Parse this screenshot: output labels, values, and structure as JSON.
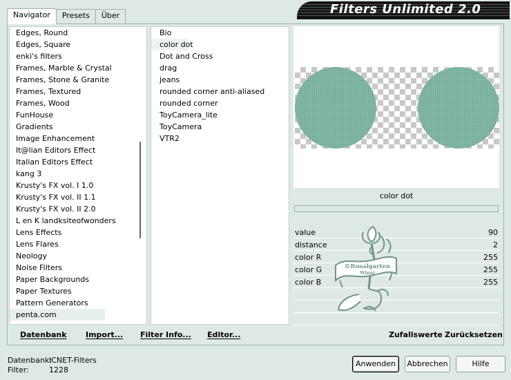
{
  "tabs": [
    "Navigator",
    "Presets",
    "Über"
  ],
  "banner": {
    "title": "Filters Unlimited 2.0"
  },
  "categories": [
    "Edges, Round",
    "Edges, Square",
    "enki's filters",
    "Frames, Marble & Crystal",
    "Frames, Stone & Granite",
    "Frames, Textured",
    "Frames, Wood",
    "FunHouse",
    "Gradients",
    "Image Enhancement",
    "It@lian Editors Effect",
    "Italian Editors Effect",
    "kang 3",
    "Krusty's FX vol. I 1.0",
    "Krusty's FX vol. II 1.1",
    "Krusty's FX vol. II 2.0",
    "L en K landksiteofwonders",
    "Lens Effects",
    "Lens Flares",
    "Neology",
    "Noise Filters",
    "Paper Backgrounds",
    "Paper Textures",
    "Pattern Generators",
    "penta.com"
  ],
  "filters": [
    "Bio",
    "color dot",
    "Dot and Cross",
    "drag",
    "jeans",
    "rounded corner anti-aliased",
    "rounded corner",
    "ToyCamera_lite",
    "ToyCamera",
    "VTR2"
  ],
  "selected_filter": "color dot",
  "params": [
    {
      "name": "value",
      "value": "90"
    },
    {
      "name": "distance",
      "value": "2"
    },
    {
      "name": "color R",
      "value": "255"
    },
    {
      "name": "color G",
      "value": "255"
    },
    {
      "name": "color B",
      "value": "255"
    }
  ],
  "watermark": {
    "line1": "©Rosalgarten",
    "line2": "Winni"
  },
  "actions": {
    "datenbank": "Datenbank",
    "import": "Import...",
    "filter_info": "Filter Info...",
    "editor": "Editor...",
    "zufallswerte": "Zufallswerte",
    "zuruecksetzen": "Zurücksetzen"
  },
  "status": {
    "datenbank_label": "Datenbank:",
    "datenbank_value": "ICNET-Filters",
    "filter_label": "Filter:",
    "filter_value": "1228"
  },
  "buttons": {
    "anwenden": "Anwenden",
    "abbrechen": "Abbrechen",
    "hilfe": "Hilfe"
  },
  "colors": {
    "dot": "#6fa896",
    "background": "#dfe9e4",
    "banner": "#141414"
  }
}
